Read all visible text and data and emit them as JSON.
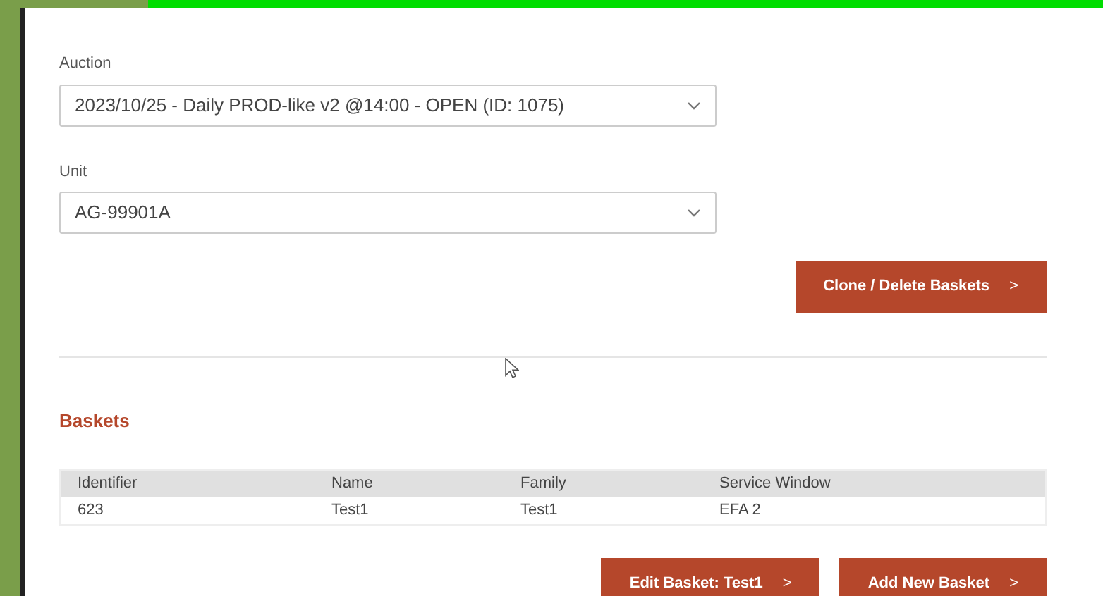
{
  "fields": [
    {
      "label": "Auction",
      "value": "2023/10/25 - Daily PROD-like v2 @14:00 - OPEN (ID: 1075)"
    },
    {
      "label": "Unit",
      "value": "AG-99901A"
    }
  ],
  "top_actions": [
    {
      "label": "Clone / Delete Baskets",
      "chevron": ">"
    }
  ],
  "section": {
    "title": "Baskets"
  },
  "table": {
    "columns": [
      "Identifier",
      "Name",
      "Family",
      "Service Window"
    ],
    "rows": [
      [
        "623",
        "Test1",
        "Test1",
        "EFA 2"
      ]
    ]
  },
  "bottom_actions": [
    {
      "label": "Edit Basket: Test1",
      "chevron": ">"
    },
    {
      "label": "Add New Basket",
      "chevron": ">"
    }
  ]
}
